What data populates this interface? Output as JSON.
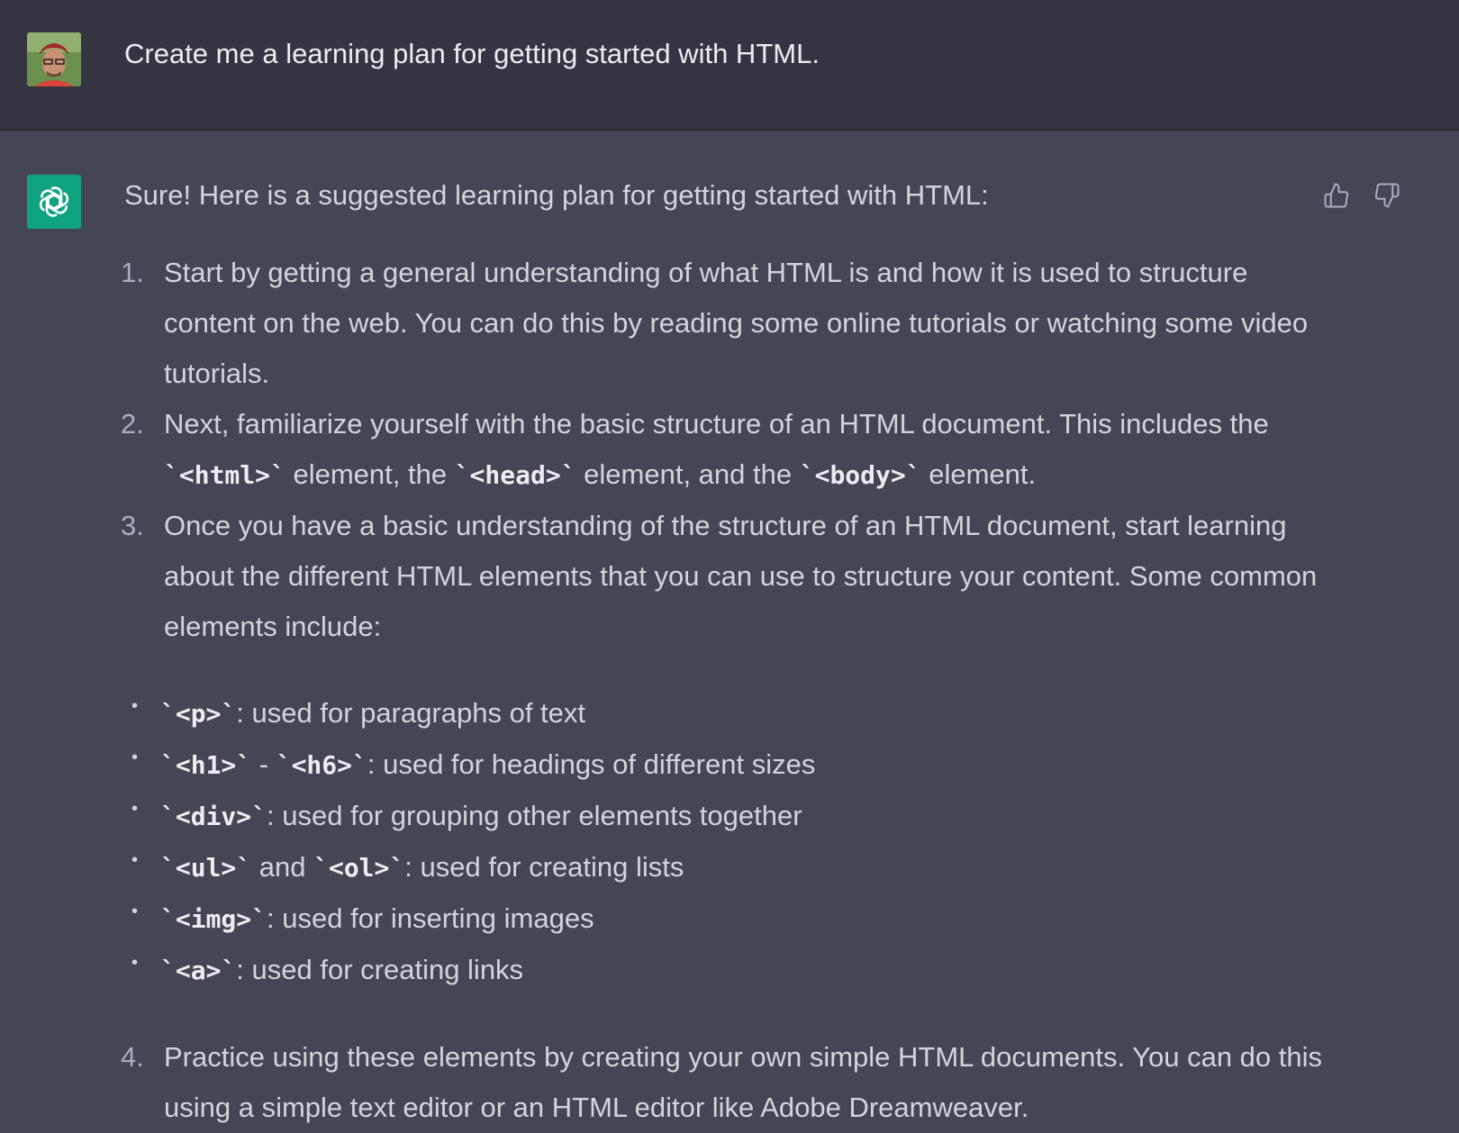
{
  "user_message": {
    "text": "Create me a learning plan for getting started with HTML."
  },
  "assistant_message": {
    "intro": "Sure! Here is a suggested learning plan for getting started with HTML:",
    "steps": [
      {
        "num": "1.",
        "text": "Start by getting a general understanding of what HTML is and how it is used to structure content on the web. You can do this by reading some online tutorials or watching some video tutorials."
      },
      {
        "num": "2.",
        "parts": [
          "Next, familiarize yourself with the basic structure of an HTML document. This includes the ",
          "`<html>`",
          " element, the ",
          "`<head>`",
          " element, and the ",
          "`<body>`",
          " element."
        ]
      },
      {
        "num": "3.",
        "text": "Once you have a basic understanding of the structure of an HTML document, start learning about the different HTML elements that you can use to structure your content. Some common elements include:"
      },
      {
        "num": "4.",
        "text": "Practice using these elements by creating your own simple HTML documents. You can do this using a simple text editor or an HTML editor like Adobe Dreamweaver."
      }
    ],
    "elements": [
      {
        "code1": "`<p>`",
        "text": ": used for paragraphs of text"
      },
      {
        "code1": "`<h1>`",
        "mid": " - ",
        "code2": "`<h6>`",
        "text": ": used for headings of different sizes"
      },
      {
        "code1": "`<div>`",
        "text": ": used for grouping other elements together"
      },
      {
        "code1": "`<ul>`",
        "mid": " and ",
        "code2": "`<ol>`",
        "text": ": used for creating lists"
      },
      {
        "code1": "`<img>`",
        "text": ": used for inserting images"
      },
      {
        "code1": "`<a>`",
        "text": ": used for creating links"
      }
    ]
  },
  "icons": {
    "bot_avatar": "openai-logo-icon",
    "user_avatar": "user-photo-avatar",
    "thumbs_up": "thumbs-up-icon",
    "thumbs_down": "thumbs-down-icon"
  },
  "colors": {
    "user_bg": "#343541",
    "assistant_bg": "#444654",
    "bot_avatar_bg": "#10a37f",
    "text": "#d1d5db"
  }
}
